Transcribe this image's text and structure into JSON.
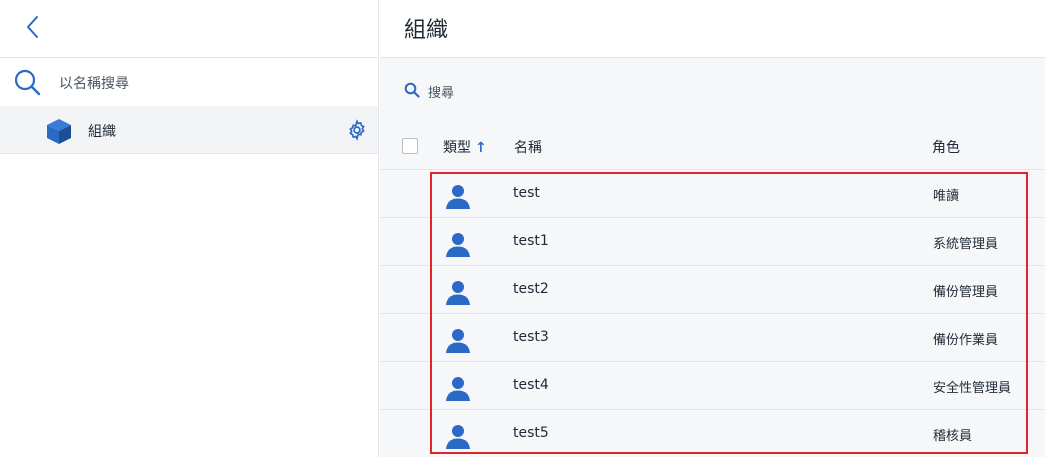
{
  "sidebar": {
    "search_placeholder": "以名稱搜尋",
    "selected_item": "組織"
  },
  "main": {
    "title": "組織",
    "search_placeholder": "搜尋",
    "columns": {
      "type": "類型",
      "name": "名稱",
      "role": "角色"
    },
    "rows": [
      {
        "name": "test",
        "role": "唯讀"
      },
      {
        "name": "test1",
        "role": "系統管理員"
      },
      {
        "name": "test2",
        "role": "備份管理員"
      },
      {
        "name": "test3",
        "role": "備份作業員"
      },
      {
        "name": "test4",
        "role": "安全性管理員"
      },
      {
        "name": "test5",
        "role": "稽核員"
      }
    ]
  },
  "colors": {
    "accent": "#2a6ac4",
    "highlight": "#e0262c"
  }
}
